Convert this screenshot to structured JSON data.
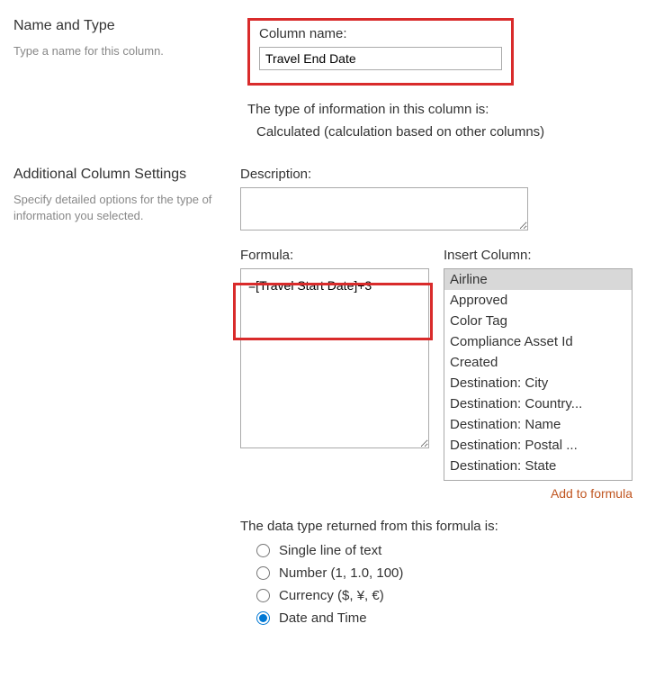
{
  "name_and_type": {
    "title": "Name and Type",
    "subtitle": "Type a name for this column.",
    "column_name_label": "Column name:",
    "column_name_value": "Travel End Date",
    "type_info_label": "The type of information in this column is:",
    "type_info_value": "Calculated (calculation based on other columns)"
  },
  "additional": {
    "title": "Additional Column Settings",
    "subtitle": "Specify detailed options for the type of information you selected.",
    "description_label": "Description:",
    "description_value": "",
    "formula_label": "Formula:",
    "formula_value": "=[Travel Start Date]+3",
    "insert_column_label": "Insert Column:",
    "insert_columns": {
      "0": "Airline",
      "1": "Approved",
      "2": "Color Tag",
      "3": "Compliance Asset Id",
      "4": "Created",
      "5": "Destination: City",
      "6": "Destination: Country...",
      "7": "Destination: Name",
      "8": "Destination: Postal ...",
      "9": "Destination: State"
    },
    "add_to_formula": "Add to formula",
    "datatype_label": "The data type returned from this formula is:",
    "radios": {
      "single": "Single line of text",
      "number": "Number (1, 1.0, 100)",
      "currency": "Currency ($, ¥, €)",
      "datetime": "Date and Time"
    }
  }
}
